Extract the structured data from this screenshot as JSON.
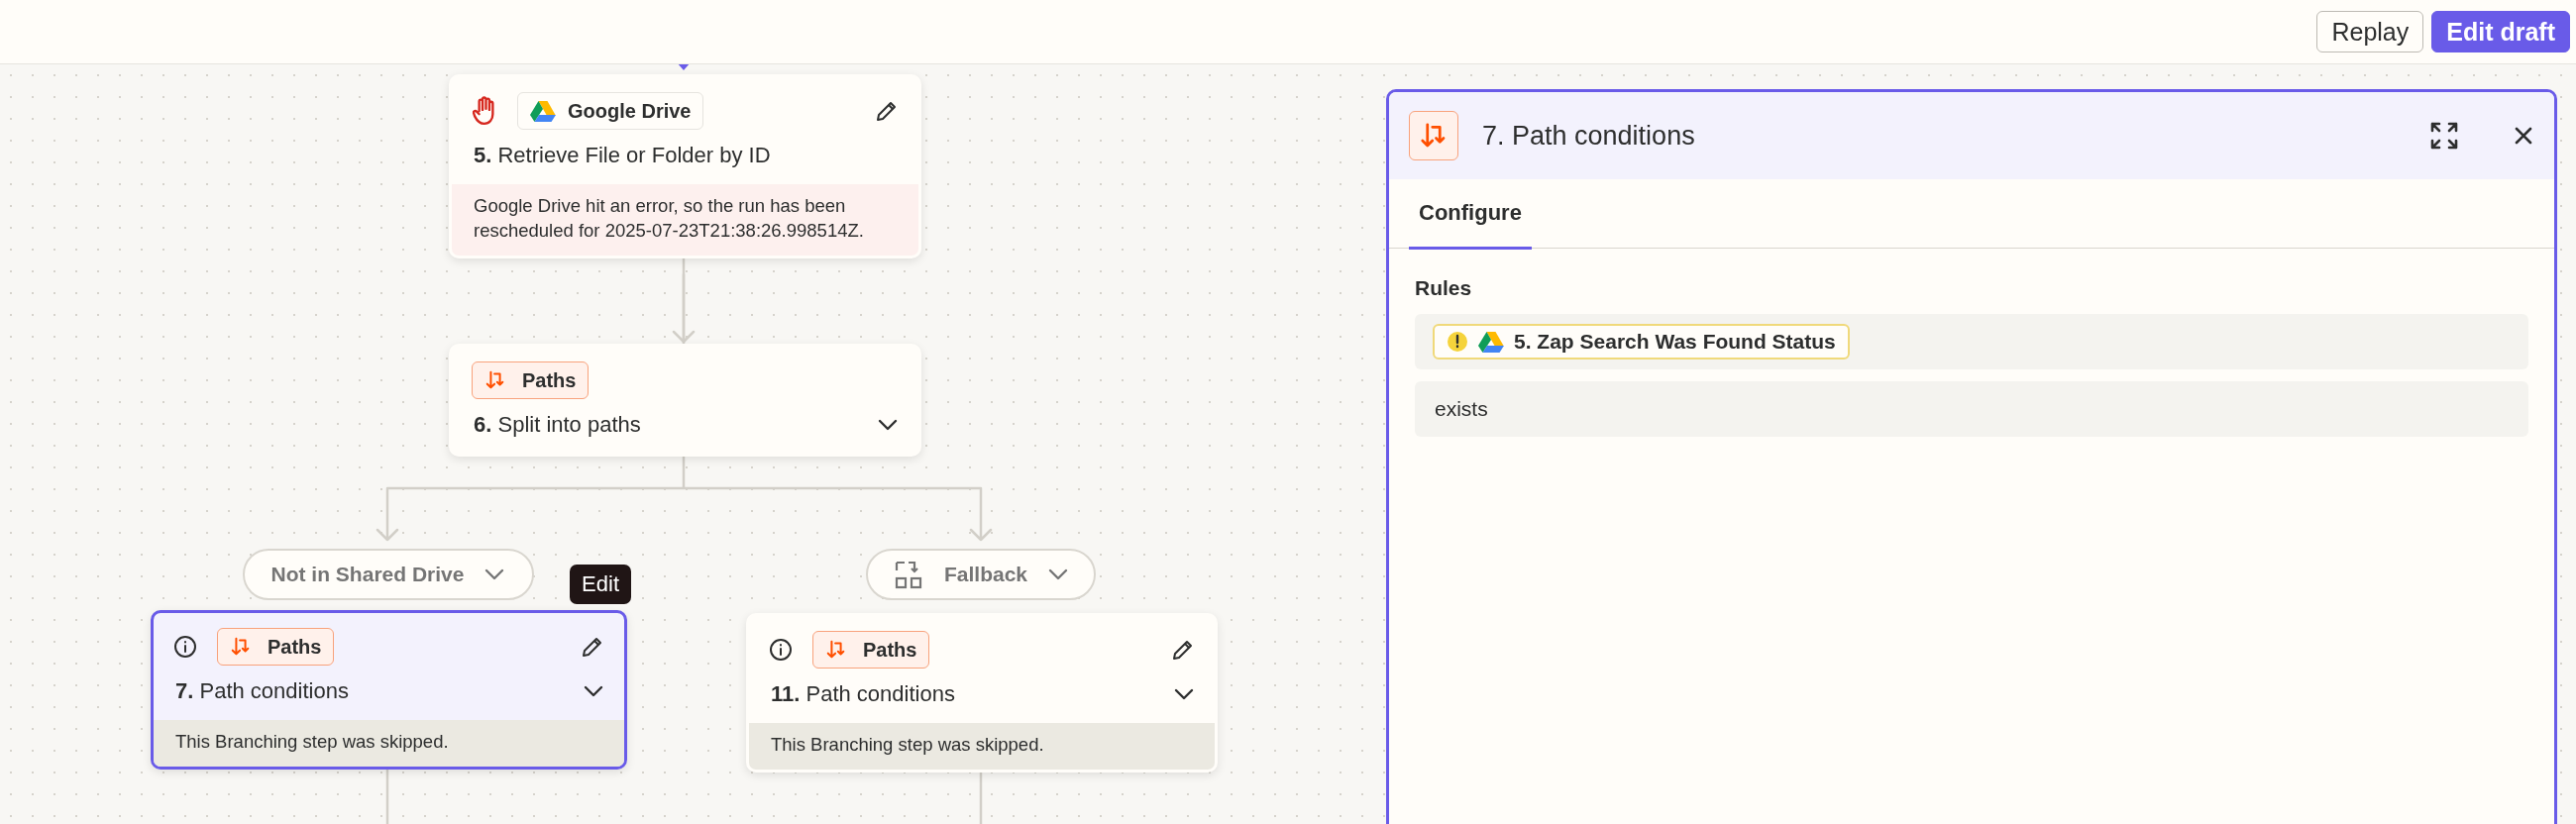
{
  "toolbar": {
    "buttons": [
      {
        "label": "Replay",
        "kind": "secondary"
      },
      {
        "label": "Edit draft",
        "kind": "primary"
      }
    ]
  },
  "canvas": {
    "steps": [
      {
        "kind": "halted",
        "badge": {
          "label": "Google Drive",
          "kind": "app"
        },
        "title": "**5.** Retrieve File or Folder by ID",
        "message": "Google Drive hit an error, so the run has been rescheduled for 2025-07-23T21:38:26.998514Z.",
        "edit": true,
        "expandable": false,
        "selected": false
      },
      {
        "kind": "plain",
        "badge": {
          "label": "Paths",
          "kind": "paths"
        },
        "title": "**6.** Split into paths",
        "edit": false,
        "expandable": true,
        "selected": false
      },
      {
        "kind": "skipped",
        "badge": {
          "label": "Paths",
          "kind": "paths"
        },
        "title": "**7.** Path conditions",
        "message": "This Branching step was skipped.",
        "edit": true,
        "expandable": true,
        "selected": true,
        "tooltip": "Edit"
      },
      {
        "kind": "skipped",
        "badge": {
          "label": "Paths",
          "kind": "paths"
        },
        "title": "**11.** Path conditions",
        "message": "This Branching step was skipped.",
        "edit": true,
        "expandable": true,
        "selected": false
      }
    ],
    "branches": [
      {
        "label": "Not in Shared Drive",
        "kind": "condition"
      },
      {
        "label": "Fallback",
        "kind": "fallback"
      }
    ]
  },
  "panel": {
    "title": "7. Path conditions",
    "tabs": [
      {
        "label": "Configure",
        "selected": true
      }
    ],
    "section": "Rules",
    "rules": [
      {
        "kind": "field",
        "label": "5. Zap Search Was Found Status",
        "warning": true
      },
      {
        "kind": "operator",
        "label": "exists"
      }
    ]
  }
}
